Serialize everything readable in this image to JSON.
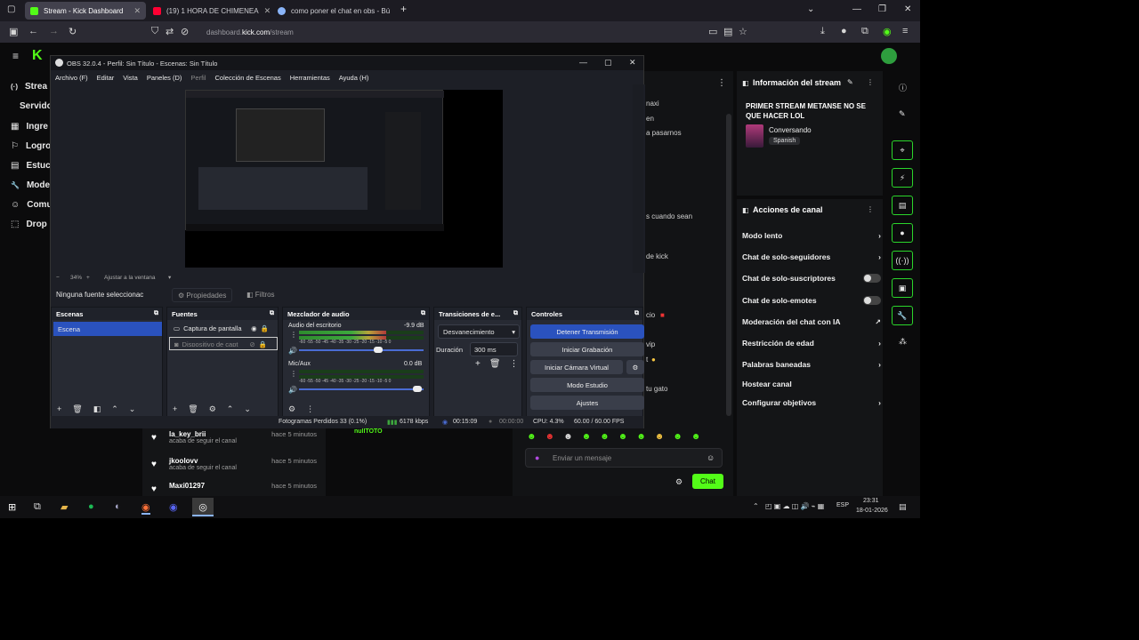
{
  "browser": {
    "tabs": [
      {
        "title": "Stream - Kick Dashboard",
        "color": "#53fc18"
      },
      {
        "title": "(19) 1 HORA DE CHIMENEA",
        "color": "#ff0033"
      },
      {
        "title": "como poner el chat en obs - Bú",
        "color": "#8ab4f8"
      }
    ],
    "new_tab": "+",
    "url_prefix": "dashboard.",
    "url_domain": "kick.com",
    "url_path": "/stream"
  },
  "kick": {
    "sidebar": [
      {
        "label": "Strea",
        "icon": "(·)"
      },
      {
        "label": "Servido",
        "icon": ""
      },
      {
        "label": "Ingre",
        "icon": "▦"
      },
      {
        "label": "Logro",
        "icon": "⚐"
      },
      {
        "label": "Estuc",
        "icon": "▤"
      },
      {
        "label": "Mode",
        "icon": "🔧"
      },
      {
        "label": "Comu",
        "icon": "☺"
      },
      {
        "label": "Drop",
        "icon": "⬚"
      }
    ],
    "chat_partial": [
      "naxi",
      "en",
      "a pasarnos",
      "s cuando sean",
      "de kick",
      "cio",
      "vip",
      "t",
      "tu gato"
    ],
    "chat_user_partial": "nullTOTO",
    "followers": [
      {
        "name": "la_key_brii",
        "sub": "acaba de seguir el canal",
        "time": "hace 5 minutos"
      },
      {
        "name": "jkoolovv",
        "sub": "acaba de seguir el canal",
        "time": "hace 5 minutos"
      },
      {
        "name": "Maxi01297",
        "sub": "",
        "time": "hace 5 minutos"
      }
    ],
    "message_placeholder": "Enviar un mensaje",
    "chat_button": "Chat",
    "stream_info": {
      "title": "Información del stream",
      "stream_title": "PRIMER STREAM METANSE NO SE QUE HACER LOL",
      "category": "Conversando",
      "language": "Spanish"
    },
    "channel_actions": {
      "title": "Acciones de canal",
      "items": [
        {
          "label": "Modo lento",
          "control": "chevron"
        },
        {
          "label": "Chat de solo-seguidores",
          "control": "chevron"
        },
        {
          "label": "Chat de solo-suscriptores",
          "control": "toggle"
        },
        {
          "label": "Chat de solo-emotes",
          "control": "toggle"
        },
        {
          "label": "Moderación del chat con IA",
          "control": "chart"
        },
        {
          "label": "Restricción de edad",
          "control": "chevron"
        },
        {
          "label": "Palabras baneadas",
          "control": "chevron"
        },
        {
          "label": "Hostear canal",
          "control": "none"
        },
        {
          "label": "Configurar objetivos",
          "control": "chevron"
        }
      ]
    }
  },
  "obs": {
    "title": "OBS 32.0.4 - Perfil: Sin Título - Escenas: Sin Título",
    "menu": [
      "Archivo (F)",
      "Editar",
      "Vista",
      "Paneles (D)",
      "Perfil",
      "Colección de Escenas",
      "Herramientas",
      "Ayuda (H)"
    ],
    "zoom": "34%",
    "zoom_mode": "Ajustar a la ventana",
    "no_source": "Ninguna fuente seleccionac",
    "properties": "Propiedades",
    "filters": "Filtros",
    "scenes": {
      "title": "Escenas",
      "items": [
        "Escena"
      ]
    },
    "sources": {
      "title": "Fuentes",
      "items": [
        "Captura de pantalla",
        "Dispositivo de capt"
      ]
    },
    "mixer": {
      "title": "Mezclador de audio",
      "channels": [
        {
          "name": "Audio del escritorio",
          "db": "-9.9 dB",
          "level": 0.7
        },
        {
          "name": "Mic/Aux",
          "db": "0.0 dB",
          "level": 0.0
        }
      ],
      "scale": "-60 -55 -50 -45 -40 -35 -30 -25 -20 -15 -10 -5 0"
    },
    "transitions": {
      "title": "Transiciones de e...",
      "selected": "Desvanecimiento",
      "duration_label": "Duración",
      "duration": "300 ms"
    },
    "controls": {
      "title": "Controles",
      "stop": "Detener Transmisión",
      "record": "Iniciar Grabación",
      "virtualcam": "Iniciar Cámara Virtual",
      "studio": "Modo Estudio",
      "settings": "Ajustes"
    },
    "status": {
      "dropped": "Fotogramas Perdidos 33 (0.1%)",
      "bitrate": "6178 kbps",
      "live_time": "00:15:09",
      "rec_time": "00:00:00",
      "cpu": "CPU: 4.3%",
      "fps": "60.00 / 60.00 FPS"
    }
  },
  "taskbar": {
    "time": "23:31",
    "date": "18-01-2026",
    "lang": "ESP"
  },
  "colors": {
    "kick_green": "#53fc18",
    "obs_blue": "#2a52be"
  }
}
